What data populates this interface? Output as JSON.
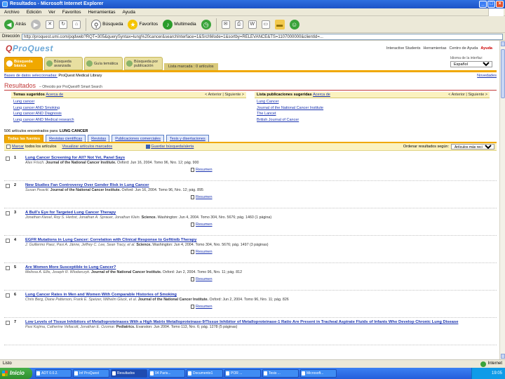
{
  "window": {
    "title": "Resultados - Microsoft Internet Explorer"
  },
  "menubar": [
    "Archivo",
    "Edición",
    "Ver",
    "Favoritos",
    "Herramientas",
    "Ayuda"
  ],
  "toolbar": {
    "back": "Atrás",
    "search": "Búsqueda",
    "favorites": "Favoritos",
    "multimedia": "Multimedia"
  },
  "address": {
    "label": "Dirección",
    "url": "http://proquest.umi.com/pqdweb?RQT=305&querySyntax=lung%20cancer&searchInterface=1&SrchMode=1&sortby=RELEVANCE&TS=1107000000&clientId=..."
  },
  "proquest": {
    "logo_a": "Pro",
    "logo_b": "Quest",
    "toplinks": [
      "Interactive Students",
      "Herramientas",
      "Centro de Ayuda"
    ],
    "exit": "Ayuda",
    "interface_label": "Idioma de la interfaz:",
    "interface_value": "Español",
    "whats_new": "Novedades"
  },
  "nav": {
    "tabs": [
      "Búsqueda básica",
      "Búsqueda avanzada",
      "Guía temática",
      "Búsqueda por publicación"
    ],
    "marked": "Lista marcada : 0 artículos"
  },
  "search": {
    "databases_link": "Bases de datos seleccionadas:",
    "databases_value": "ProQuest Medical Library",
    "clear_link": ""
  },
  "results": {
    "title": "Resultados",
    "powered": "– Ofrecido por ProQuest® Smart Search"
  },
  "suggested_topics": {
    "label": "Temas sugeridos",
    "about": "Acerca de",
    "controls": "< Anterior | Siguiente >",
    "items": [
      "Lung cancer",
      "Lung cancer AND Smoking",
      "Lung cancer AND Diagnosis",
      "Lung cancer AND Medical research"
    ]
  },
  "suggested_pubs": {
    "label": "Lista publicaciones sugeridas",
    "about": "Acerca de",
    "controls": "< Anterior | Siguiente >",
    "items": [
      "Lung Cancer",
      "Journal of the National Cancer Institute",
      "The Lancet",
      "British Journal of Cancer"
    ]
  },
  "found": {
    "text": "506 artículos encontrados para:",
    "query": "LUNG CANCER"
  },
  "source_tabs": [
    "Todas las fuentes",
    "Revistas científicas",
    "Revistas",
    "Publicaciones comerciales",
    "Tesis y disertaciones"
  ],
  "actions": {
    "mark_all": "Marcar",
    "mark_all_rest": "todos los artículos",
    "view_marked": "Visualizar artículos marcados",
    "save_alert": "Guardar búsqueda/alerta",
    "sort_label": "Ordenar resultados según:",
    "sort_value": "Artículos más recientes"
  },
  "results_list": [
    {
      "num": "1",
      "title": "Lung Cancer Screening for All? Not Yet, Panel Says",
      "authors": "Alex Frisch.",
      "journal": "Journal of the National Cancer Institute.",
      "details": "Oxford: Jun 16, 2004. Tomo 96, Nro. 12; pág. 900",
      "link": "Resumen"
    },
    {
      "num": "2",
      "title": "New Studies Fan Controversy Over Gender Risk in Lung Cancer",
      "authors": "Susan Peavitt.",
      "journal": "Journal of the National Cancer Institute.",
      "details": "Oxford: Jun 16, 2004. Tomo 96, Nro. 12; pág. 895",
      "link": "Resumen"
    },
    {
      "num": "3",
      "title": "A Bull's Eye for Targeted Lung Cancer Therapy",
      "authors": "Jonathan Kiesel, Roy S. Herbst, Jonathan A. Sprauer, Jonathan Klein.",
      "journal": "Science.",
      "details": "Washington: Jun 4, 2004. Tomo 304, Nro. 5676; pág. 1460 (1 página)",
      "link": "Resumen"
    },
    {
      "num": "4",
      "title": "EGFR Mutations in Lung Cancer: Correlation with Clinical Response to Gefitinib Therapy",
      "authors": "J. Guillermo Paez, Pasi A. Jänne, Jeffrey C. Lee, Sean Tracy, et al.",
      "journal": "Science.",
      "details": "Washington: Jun 4, 2004. Tomo 304, Nro. 5676; pág. 1497 (3 páginas)",
      "link": "Resumen"
    },
    {
      "num": "5",
      "title": "Are Women More Susceptible to Lung Cancer?",
      "authors": "Melissa A. Ellis, Joseph R. Wlodarczyk.",
      "journal": "Journal of the National Cancer Institute.",
      "details": "Oxford: Jun 2, 2004. Tomo 96, Nro. 11; pág. 812",
      "link": "Resumen"
    },
    {
      "num": "6",
      "title": "Lung Cancer Rates in Men and Women With Comparable Histories of Smoking",
      "authors": "Chris Berg, Diane Patterson, Frank E. Speizer, Wilhelm Gluck, et al.",
      "journal": "Journal of the National Cancer Institute.",
      "details": "Oxford: Jun 2, 2004. Tomo 96, Nro. 11; pág. 826",
      "link": "Resumen"
    },
    {
      "num": "7",
      "title": "Low Levels of Tissue Inhibitors of Metalloproteinases With a High Matrix Metalloproteinase-9/Tissue Inhibitor of Metalloproteinase-1 Ratio Are Present in Tracheal Aspirate Fluids of Infants Who Develop Chronic Lung Disease",
      "authors": "Pasi Kojima, Catherine Vellacott, Jonathan E. Ozomar.",
      "journal": "Pediatrics.",
      "details": "Evanston: Jun 2004. Tomo 113, Nro. 6; pág. 1278 (5 páginas)",
      "link": "Resumen"
    }
  ],
  "statusbar": {
    "left": "Listo",
    "zone": "Internet"
  },
  "taskbar": {
    "start": "Inicio",
    "items": [
      "ADT 0.0.2.",
      "Inf ProQuest",
      "Resultados",
      "04 Paris...",
      "Documento1",
      "POR ...",
      "Tesis ...",
      "Microsoft..."
    ],
    "clock": "19:05"
  }
}
